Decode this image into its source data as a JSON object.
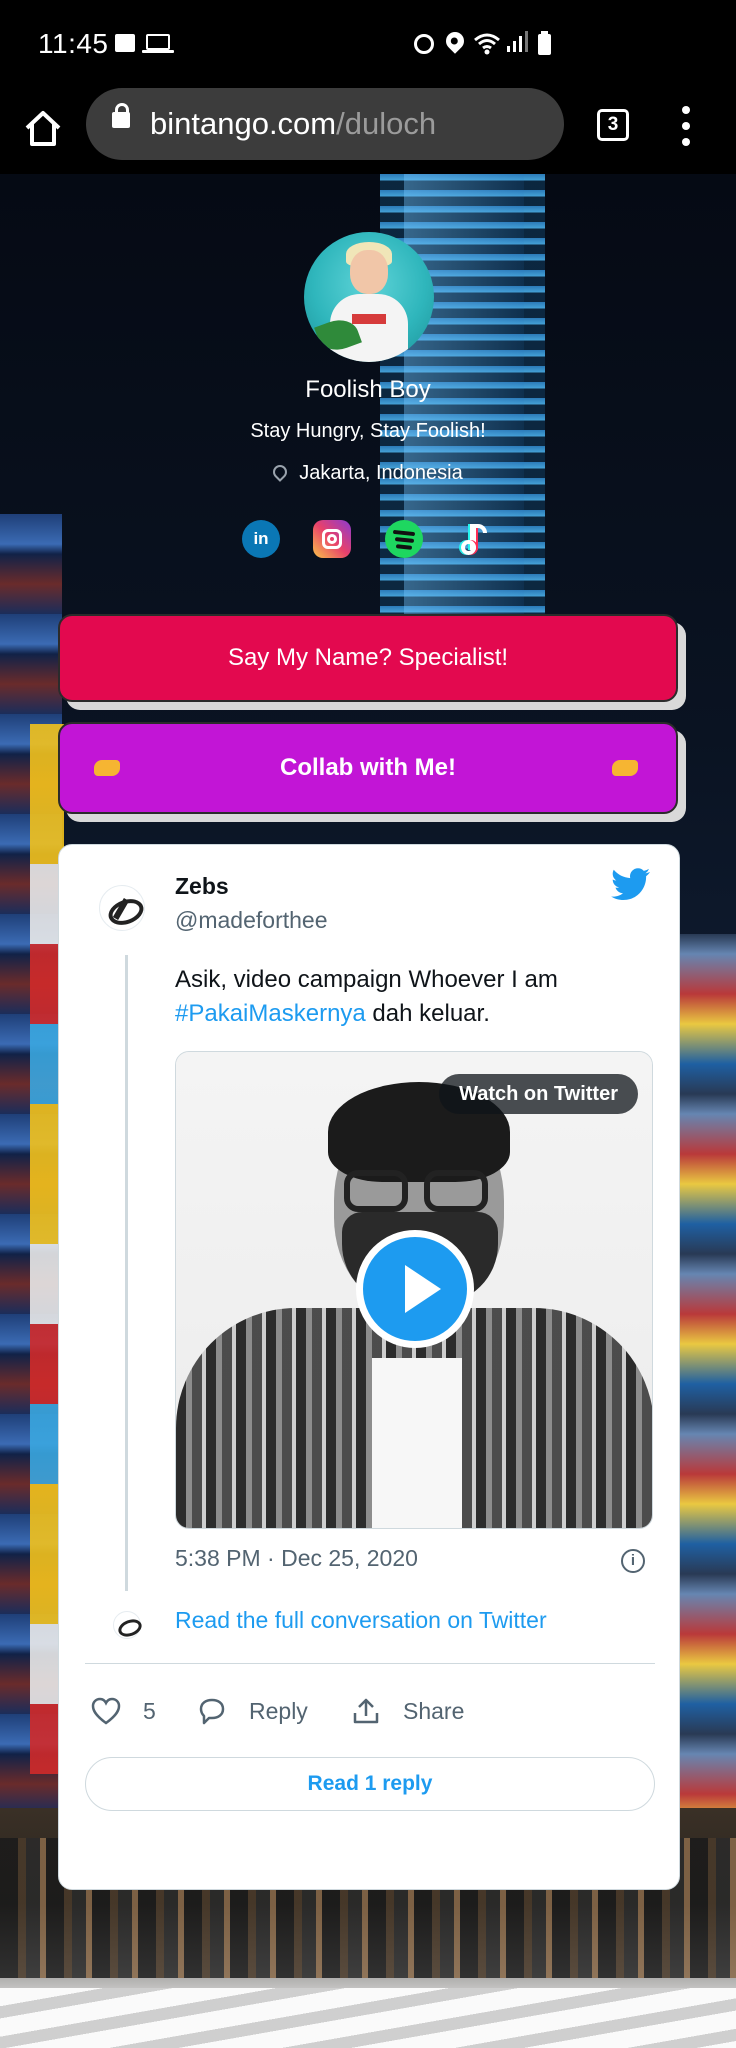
{
  "status_bar": {
    "time": "11:45",
    "left_icons": [
      "image-icon",
      "laptop-icon"
    ],
    "right_icons": [
      "alarm-icon",
      "location-icon",
      "wifi-icon",
      "signal-icon",
      "battery-icon"
    ]
  },
  "browser": {
    "url_domain": "bintango.com",
    "url_path": "/duloch",
    "tab_count": "3",
    "icons": [
      "home-icon",
      "lock-icon",
      "tabs-icon",
      "more-vert-icon"
    ]
  },
  "profile": {
    "name": "Foolish Boy",
    "bio": "Stay Hungry, Stay Foolish!",
    "location": "Jakarta, Indonesia",
    "socials": [
      "linkedin",
      "instagram",
      "spotify",
      "tiktok"
    ],
    "linkedin_label": "in"
  },
  "links": [
    {
      "label": "Say My Name? Specialist!",
      "color": "#e3094f"
    },
    {
      "label": "Collab with Me!",
      "color": "#c215d6"
    }
  ],
  "tweet": {
    "author_name": "Zebs",
    "author_handle": "@madeforthee",
    "text_before": "Asik, video campaign Whoever I am",
    "hashtag": "#PakaiMaskernya",
    "text_after": " dah keluar.",
    "watch_label": "Watch on Twitter",
    "timestamp": "5:38 PM · Dec 25, 2020",
    "info_glyph": "i",
    "conversation_link": "Read the full conversation on Twitter",
    "like_count": "5",
    "reply_label": "Reply",
    "share_label": "Share",
    "read_replies_label": "Read 1 reply",
    "accent_color": "#1d9bf0"
  }
}
